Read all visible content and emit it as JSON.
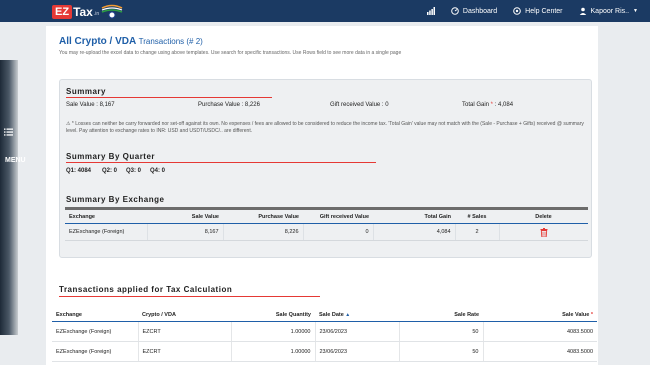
{
  "nav": {
    "logo_ez": "EZ",
    "logo_tax": "Tax",
    "logo_in": ".in",
    "dashboard": "Dashboard",
    "help": "Help Center",
    "user": "Kapoor Ris..",
    "brand_red": "#e53935",
    "nav_bg": "#1b3a63"
  },
  "side": {
    "menu": "MENU"
  },
  "page": {
    "title": "All Crypto / VDA",
    "title_sub": "Transactions (# 2)",
    "desc": "You may re-upload the excel data to change using above templates. Use search for specific transactions. Use Rows field to see more data in a single page"
  },
  "summary": {
    "heading": "Summary",
    "sale_value": "Sale Value : 8,167",
    "purchase_value": "Purchase Value : 8,226",
    "gift_value": "Gift received Value : 0",
    "total_gain_label": "Total Gain",
    "total_gain_value": ": 4,084",
    "note": "⚠ * Losses can neither be carry forwarded nor set-off against its own. No expenses / fees are allowed to be considered to reduce the income tax. 'Total Gain' value may not match with the (Sale - Purchase + Gifts) received @ summary level. Pay attention to exchange rates to INR: USD and USDT/USDC/.. are different."
  },
  "quarter": {
    "heading": "Summary By Quarter",
    "q1": "Q1: 4084",
    "q2": "Q2: 0",
    "q3": "Q3: 0",
    "q4": "Q4: 0"
  },
  "exchange": {
    "heading": "Summary By Exchange",
    "headers": {
      "exchange": "Exchange",
      "sale": "Sale Value",
      "purchase": "Purchase Value",
      "gift": "Gift received Value",
      "gain": "Total Gain",
      "sales": "# Sales",
      "delete": "Delete"
    },
    "rows": [
      {
        "exchange": "EZExchange (Foreign)",
        "sale": "8,167",
        "purchase": "8,226",
        "gift": "0",
        "gain": "4,084",
        "sales": "2"
      }
    ]
  },
  "transactions": {
    "heading": "Transactions applied for Tax Calculation",
    "headers": {
      "exchange": "Exchange",
      "crypto": "Crypto / VDA",
      "qty": "Sale Quantity",
      "date": "Sale Date",
      "rate": "Sale Rate",
      "value": "Sale Value"
    },
    "rows": [
      {
        "exchange": "EZExchange (Foreign)",
        "crypto": "EZCRT",
        "qty": "1.00000",
        "date": "23/06/2023",
        "rate": "50",
        "value": "4083.5000"
      },
      {
        "exchange": "EZExchange (Foreign)",
        "crypto": "EZCRT",
        "qty": "1.00000",
        "date": "23/06/2023",
        "rate": "50",
        "value": "4083.5000"
      }
    ]
  }
}
